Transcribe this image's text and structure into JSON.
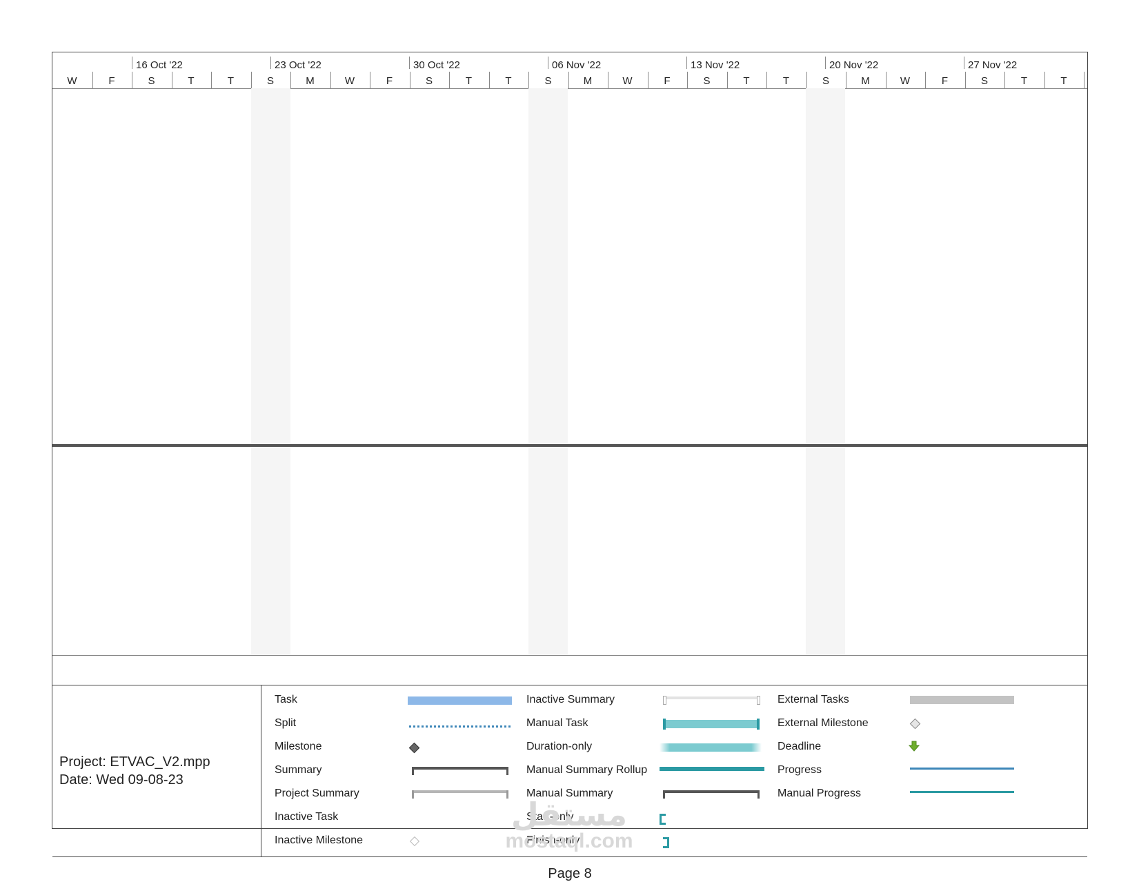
{
  "timescale": {
    "weeks": [
      "16 Oct '22",
      "23 Oct '22",
      "30 Oct '22",
      "06 Nov '22",
      "13 Nov '22",
      "20 Nov '22",
      "27 Nov '22"
    ],
    "days": [
      "W",
      "F",
      "S",
      "T",
      "T",
      "S",
      "M",
      "W",
      "F",
      "S",
      "T",
      "T",
      "S",
      "M",
      "W",
      "F",
      "S",
      "T",
      "T",
      "S",
      "M",
      "W",
      "F",
      "S",
      "T",
      "T"
    ]
  },
  "legend_info": {
    "project": "Project: ETVAC_V2.mpp",
    "date": "Date: Wed 09-08-23"
  },
  "legend": {
    "col1": [
      "Task",
      "Split",
      "Milestone",
      "Summary",
      "Project Summary",
      "Inactive Task",
      "Inactive Milestone"
    ],
    "col2": [
      "Inactive Summary",
      "Manual Task",
      "Duration-only",
      "Manual Summary Rollup",
      "Manual Summary",
      "Start-only",
      "Finish-only"
    ],
    "col3": [
      "External Tasks",
      "External Milestone",
      "Deadline",
      "Progress",
      "Manual Progress"
    ]
  },
  "colors": {
    "task": "#8db8e8",
    "manual_task": "#7ccbd0",
    "teal": "#2b9aa3",
    "summary": "#555555",
    "project_summary": "#b5b5b5",
    "external": "#c3c3c3",
    "deadline": "#6fae2d",
    "progress": "#3d86b8"
  },
  "footer": {
    "page": "Page 8"
  },
  "watermark": {
    "arabic": "مستقل",
    "latin": "mostaql.com"
  }
}
